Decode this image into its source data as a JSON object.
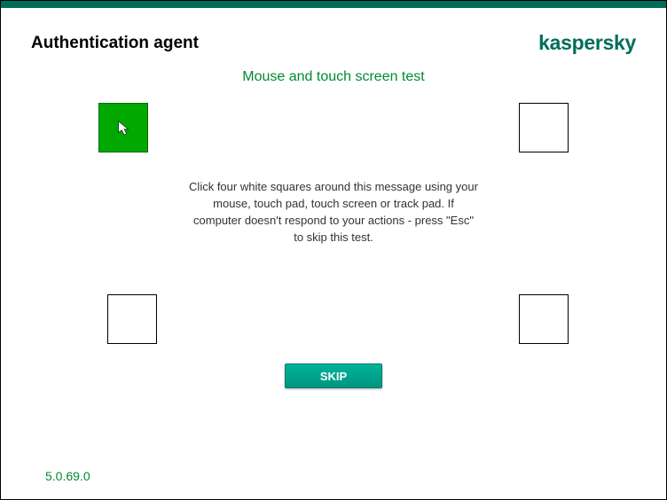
{
  "header": {
    "app_title": "Authentication agent",
    "brand": "kaspersky"
  },
  "main": {
    "subtitle": "Mouse and touch screen test",
    "instructions": "Click four white squares around this message using your\nmouse, touch pad, touch screen or track pad. If\ncomputer doesn't respond to your actions - press \"Esc\"\nto skip this test.",
    "skip_label": "SKIP"
  },
  "squares": {
    "top_left_clicked": true,
    "top_right_clicked": false,
    "bottom_left_clicked": false,
    "bottom_right_clicked": false
  },
  "footer": {
    "version": "5.0.69.0"
  },
  "colors": {
    "accent": "#006d5b",
    "subtitle_green": "#008a32",
    "square_active": "#00a800"
  }
}
